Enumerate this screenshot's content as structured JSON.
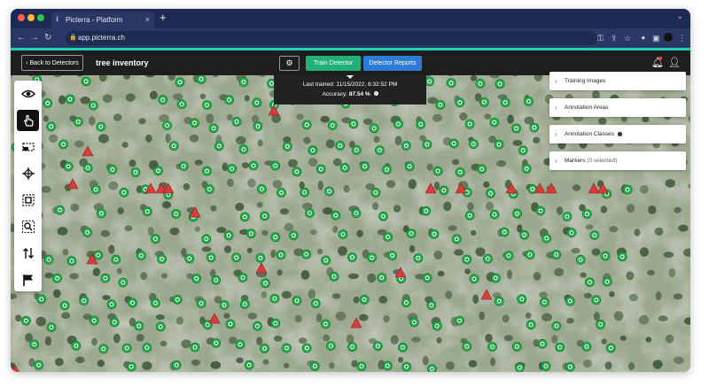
{
  "browser": {
    "tab_title": "Picterra - Platform",
    "url": "app.picterra.ch",
    "new_tab_symbol": "+",
    "tab_close_symbol": "×"
  },
  "appbar": {
    "back_label": "Back to Detectors",
    "title": "tree inventory",
    "train_label": "Train Detector",
    "reports_label": "Detector Reports"
  },
  "info": {
    "last_trained": "Last trained: 11/15/2022, 6:32:52 PM",
    "accuracy_label": "Accuracy:",
    "accuracy_value": "87.54 %"
  },
  "panels": [
    {
      "label": "Training Images",
      "suffix": ""
    },
    {
      "label": "Annotation Areas",
      "suffix": ""
    },
    {
      "label": "Annotation Classes",
      "suffix": ""
    },
    {
      "label": "Markers",
      "suffix": "(0 selected)"
    }
  ],
  "tools": [
    {
      "icon": "eye-icon"
    },
    {
      "icon": "hand-pointer-icon",
      "active": true
    },
    {
      "icon": "rectangle-select-icon"
    },
    {
      "icon": "polygon-draw-icon"
    },
    {
      "icon": "square-select-icon"
    },
    {
      "icon": "zoom-area-icon"
    },
    {
      "icon": "swap-arrows-icon"
    },
    {
      "icon": "flag-icon"
    }
  ],
  "colors": {
    "accent": "#1dd3b0",
    "train_button": "#21b07a",
    "reports_button": "#2e7bd6",
    "detection_marker": "#22b14c",
    "negative_marker": "#d93a3a",
    "browser_chrome": "#1f2a52"
  }
}
